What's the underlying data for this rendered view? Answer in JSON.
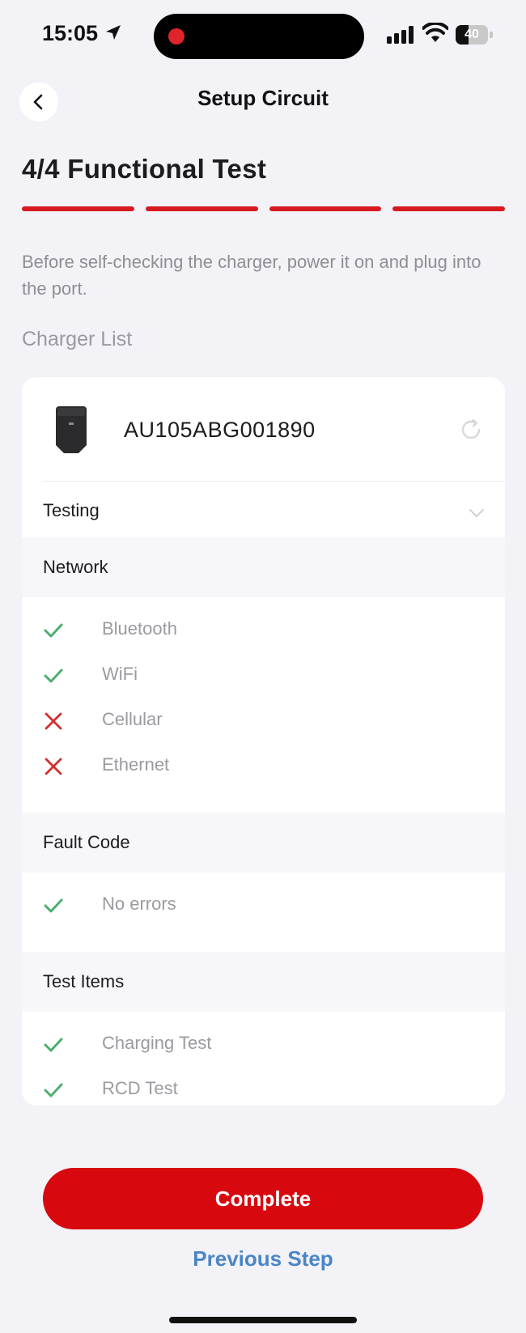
{
  "status_bar": {
    "time": "15:05",
    "battery_level": "40",
    "battery_fraction": 0.4
  },
  "header": {
    "title": "Setup Circuit",
    "back_icon": "chevron-left-icon"
  },
  "step": {
    "title": "4/4 Functional Test",
    "current": 4,
    "total": 4,
    "accent_color": "#d71920"
  },
  "instruction": "Before self-checking the charger, power it on and plug into the port.",
  "charger_list": {
    "label": "Charger List",
    "charger": {
      "id": "AU105ABG001890",
      "status": "Testing"
    },
    "groups": [
      {
        "title": "Network",
        "items": [
          {
            "label": "Bluetooth",
            "result": "pass"
          },
          {
            "label": "WiFi",
            "result": "pass"
          },
          {
            "label": "Cellular",
            "result": "fail"
          },
          {
            "label": "Ethernet",
            "result": "fail"
          }
        ]
      },
      {
        "title": "Fault Code",
        "items": [
          {
            "label": "No errors",
            "result": "pass"
          }
        ]
      },
      {
        "title": "Test Items",
        "items": [
          {
            "label": "Charging Test",
            "result": "pass"
          },
          {
            "label": "RCD Test",
            "result": "pass"
          }
        ]
      }
    ]
  },
  "colors": {
    "pass": "#4caf6e",
    "fail": "#d32f2f",
    "primary_button": "#d7090f",
    "link": "#4a86c5"
  },
  "actions": {
    "complete": "Complete",
    "previous": "Previous Step"
  }
}
